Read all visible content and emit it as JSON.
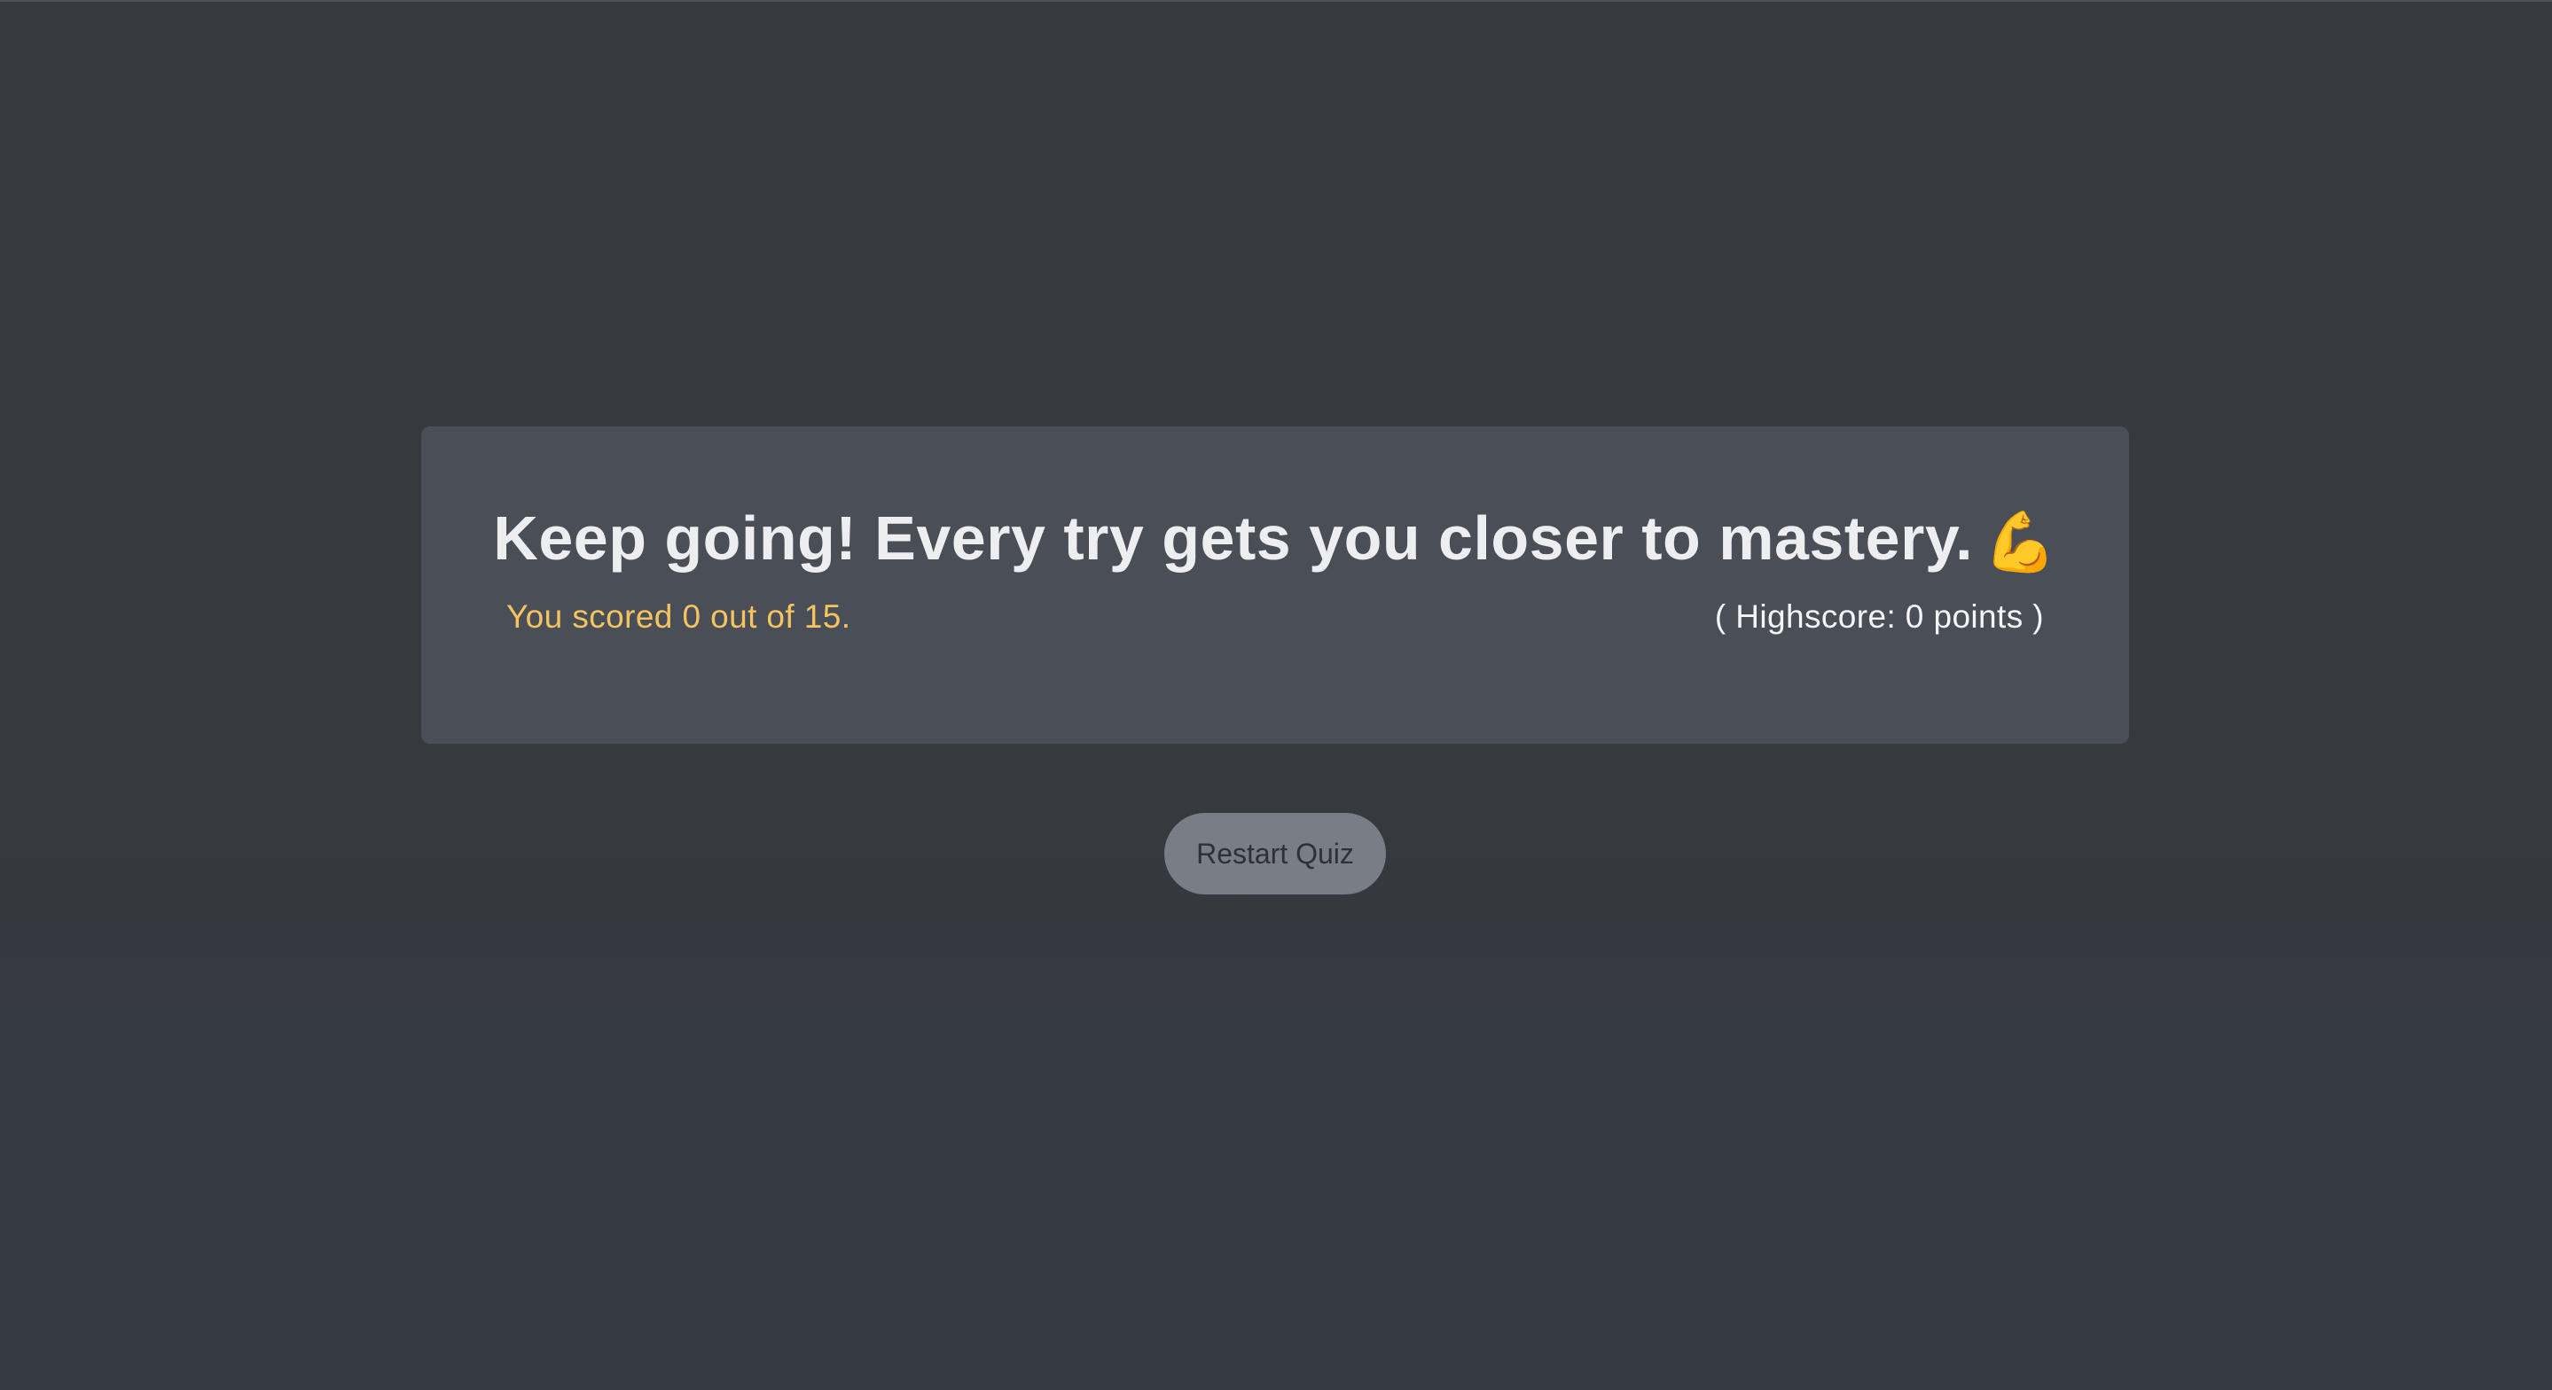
{
  "result": {
    "message": "Keep going! Every try gets you closer to mastery.",
    "emoji": "💪",
    "emoji_name": "flexed-biceps-icon",
    "score_text": "You scored 0 out of 15.",
    "highscore_text": "( Highscore: 0 points )"
  },
  "actions": {
    "restart_label": "Restart Quiz"
  },
  "colors": {
    "page_background": "#363a3e",
    "card_background": "#4a4f57",
    "score_color": "#f5c461",
    "button_background": "#787d86"
  }
}
